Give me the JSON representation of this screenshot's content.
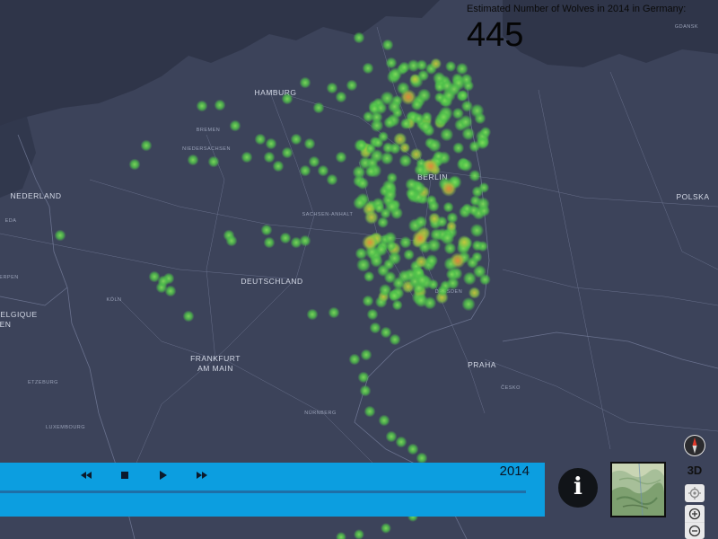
{
  "overlay": {
    "title": "Estimated Number of Wolves in 2014 in Germany:",
    "count": "445"
  },
  "timeline": {
    "year": "2014",
    "progress_fraction": 0.0,
    "controls": {
      "rewind": "rewind-icon",
      "stop": "stop-icon",
      "play": "play-icon",
      "forward": "fast-forward-icon"
    }
  },
  "map_labels": [
    {
      "name": "map-label-hamburg",
      "text": "HAMBURG",
      "cls": "major"
    },
    {
      "name": "map-label-bremen",
      "text": "BREMEN",
      "cls": "minor"
    },
    {
      "name": "map-label-niedersachsen",
      "text": "NIEDERSACHSEN",
      "cls": "minor"
    },
    {
      "name": "map-label-nederland",
      "text": "NEDERLAND",
      "cls": "major"
    },
    {
      "name": "map-label-berlin",
      "text": "BERLIN",
      "cls": "major"
    },
    {
      "name": "map-label-deutschland",
      "text": "DEUTSCHLAND",
      "cls": "major"
    },
    {
      "name": "map-label-koln",
      "text": "KÖLN",
      "cls": "minor"
    },
    {
      "name": "map-label-frankfurt",
      "text": "FRANKFURT",
      "cls": "major"
    },
    {
      "name": "map-label-am-main",
      "text": "AM MAIN",
      "cls": "major"
    },
    {
      "name": "map-label-praha",
      "text": "PRAHA",
      "cls": "major"
    },
    {
      "name": "map-label-cesko",
      "text": "ČESKO",
      "cls": "minor"
    },
    {
      "name": "map-label-luxembourg",
      "text": "LUXEMBOURG",
      "cls": "minor"
    },
    {
      "name": "map-label-nurnberg",
      "text": "NÜRNBERG",
      "cls": "minor"
    },
    {
      "name": "map-label-polska",
      "text": "POLSKA",
      "cls": "major"
    },
    {
      "name": "map-label-gdansk",
      "text": "GDANSK",
      "cls": "minor"
    },
    {
      "name": "map-label-dresden",
      "text": "DRESDEN",
      "cls": "minor"
    },
    {
      "name": "map-label-belgique",
      "text": "BELGIQUE",
      "cls": "major"
    },
    {
      "name": "map-label-sachsen",
      "text": "SACHSEN-ANHALT",
      "cls": "minor"
    },
    {
      "name": "map-label-eda",
      "text": "EDA",
      "cls": "minor"
    },
    {
      "name": "map-label-erpen",
      "text": "ERPEN",
      "cls": "minor"
    },
    {
      "name": "map-label-en",
      "text": "EN",
      "cls": "major"
    },
    {
      "name": "map-label-etzeburg",
      "text": "ETZEBURG",
      "cls": "minor"
    }
  ],
  "heat_colors": {
    "low": "#4fc24a",
    "mid": "#a6c23c",
    "high": "#d9903a",
    "map_bg": "#3c435a",
    "timeline_bg": "#0c9ee0"
  },
  "map_controls": {
    "compass": "compass-icon",
    "mode_3d": "3D",
    "locate": "locate-icon",
    "zoom_in": "zoom-in-icon",
    "zoom_out": "zoom-out-icon"
  },
  "info_button": {
    "label": "i"
  }
}
